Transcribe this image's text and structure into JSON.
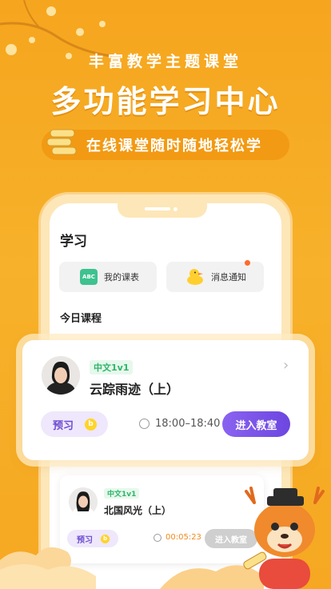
{
  "header": {
    "subtitle": "丰富教学主题课堂",
    "title": "多功能学习中心",
    "tagline": "在线课堂随时随地轻松学"
  },
  "app": {
    "page_title": "学习",
    "quick_actions": [
      {
        "label": "我的课表",
        "icon": "calendar-abc-icon"
      },
      {
        "label": "消息通知",
        "icon": "duck-icon"
      }
    ],
    "calendar_text": "ABC",
    "section_title": "今日课程",
    "courses": [
      {
        "tag": "中文1v1",
        "title": "云踪雨迹（上）",
        "preview": "预习",
        "coin": "b",
        "time": "18:00–18:40",
        "action": "进入教室"
      },
      {
        "tag": "中文1v1",
        "title": "北国风光（上）",
        "preview": "预习",
        "coin": "b",
        "time": "00:05:23",
        "action": "进入教室"
      }
    ]
  },
  "colors": {
    "brand": "#f6ad22",
    "accent": "#7654e6",
    "tag_green": "#2fb56a",
    "countdown": "#f08a1c"
  }
}
